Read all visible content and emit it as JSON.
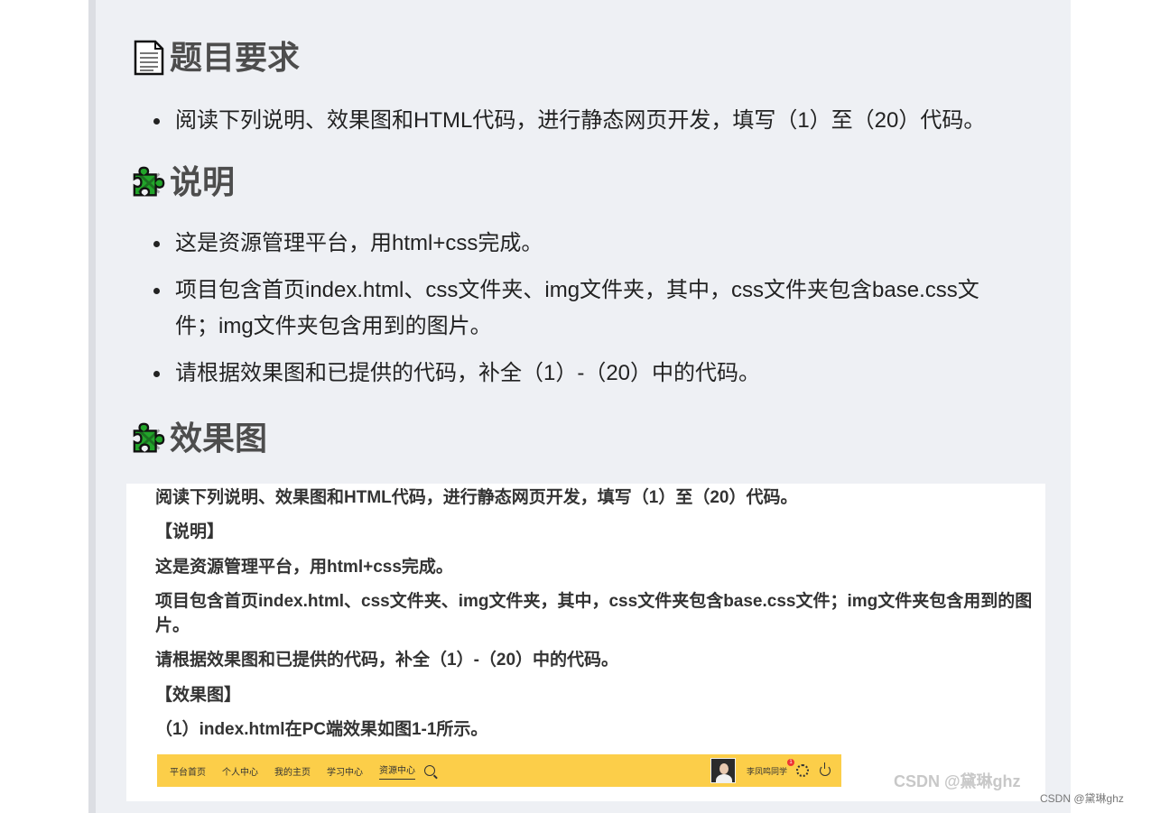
{
  "section1": {
    "title": "题目要求",
    "icon": "document-icon",
    "items": [
      "阅读下列说明、效果图和HTML代码，进行静态网页开发，填写（1）至（20）代码。"
    ]
  },
  "section2": {
    "title": "说明",
    "icon": "green-puzzle-icon",
    "items": [
      "这是资源管理平台，用html+css完成。",
      "项目包含首页index.html、css文件夹、img文件夹，其中，css文件夹包含base.css文件；img文件夹包含用到的图片。",
      "请根据效果图和已提供的代码，补全（1）-（20）中的代码。"
    ]
  },
  "section3": {
    "title": "效果图",
    "icon": "green-puzzle-icon"
  },
  "shot": {
    "line1": "阅读下列说明、效果图和HTML代码，进行静态网页开发，填写（1）至（20）代码。",
    "line2": "【说明】",
    "line3": "这是资源管理平台，用html+css完成。",
    "line4": "项目包含首页index.html、css文件夹、img文件夹，其中，css文件夹包含base.css文件；img文件夹包含用到的图片。",
    "line5": "请根据效果图和已提供的代码，补全（1）-（20）中的代码。",
    "line6": "【效果图】",
    "line7": "（1）index.html在PC端效果如图1-1所示。",
    "nav": [
      "平台首页",
      "个人中心",
      "我的主页",
      "学习中心",
      "资源中心"
    ],
    "username": "李凤鸣同学",
    "badge": "1",
    "colors": {
      "navbar": "#fcce49"
    }
  },
  "watermark": {
    "image": "CSDN @黛琳ghz",
    "page": "CSDN @黛琳ghz"
  }
}
